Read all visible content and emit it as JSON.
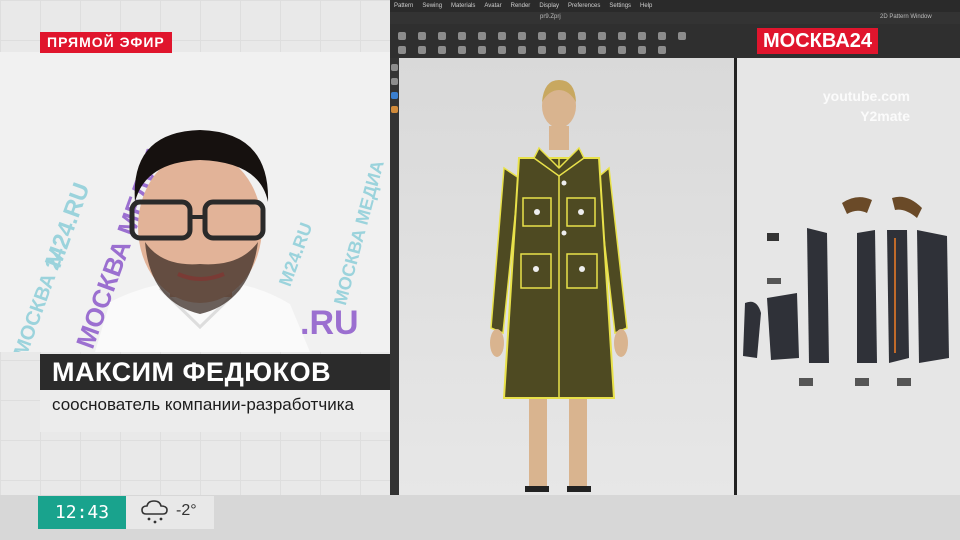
{
  "live": {
    "label": "ПРЯМОЙ ЭФИР"
  },
  "speaker": {
    "name": "МАКСИМ ФЕДЮКОВ",
    "title": "сооснователь компании-разработчика"
  },
  "background_words": [
    "M24.RU",
    "МОСКВА МЕДИА",
    "МОСКВА 24",
    "M24.RU",
    "МОСКВА МЕДИА",
    ".RU"
  ],
  "channel": {
    "logo": "МОСКВА24",
    "color": "#e0152d"
  },
  "watermark": {
    "line1": "youtube.com",
    "line2": "Y2mate"
  },
  "app": {
    "menu": [
      "Pattern",
      "Sewing",
      "Materials",
      "Avatar",
      "Render",
      "Display",
      "Preferences",
      "Settings",
      "Help"
    ],
    "doc_tab": "pr9.Zprj",
    "pattern_tab": "2D Pattern Window"
  },
  "ticker": {
    "time": "12:43",
    "temperature": "-2°",
    "weather_icon": "snow-cloud-icon"
  },
  "colors": {
    "accent": "#e0152d",
    "clock": "#19a38d",
    "garment": "#4e4a22",
    "topstitch": "#e8e14a"
  }
}
